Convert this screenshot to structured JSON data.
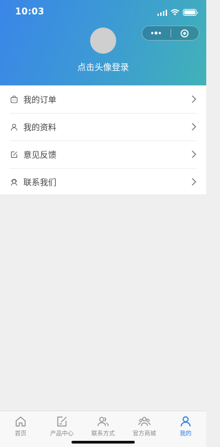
{
  "status_bar": {
    "time": "10:03"
  },
  "header": {
    "login_text": "点击头像登录",
    "capsule": {
      "more_icon": "more-dots-icon",
      "close_icon": "target-circle-icon"
    }
  },
  "menu": {
    "items": [
      {
        "label": "我的订单",
        "icon": "order-bag-icon"
      },
      {
        "label": "我的资料",
        "icon": "user-icon"
      },
      {
        "label": "意见反馈",
        "icon": "edit-icon"
      },
      {
        "label": "联系我们",
        "icon": "contact-headset-icon"
      }
    ]
  },
  "tabbar": {
    "tabs": [
      {
        "label": "首页",
        "icon": "home-icon",
        "active": false
      },
      {
        "label": "产品中心",
        "icon": "edit-square-icon",
        "active": false
      },
      {
        "label": "联系方式",
        "icon": "users-icon",
        "active": false
      },
      {
        "label": "官方商城",
        "icon": "group-icon",
        "active": false
      },
      {
        "label": "我的",
        "icon": "user-icon",
        "active": true
      }
    ]
  },
  "colors": {
    "header_gradient_start": "#3a86e8",
    "header_gradient_end": "#41b2b8",
    "active_tab": "#2f7fe3",
    "background": "#efefef"
  }
}
